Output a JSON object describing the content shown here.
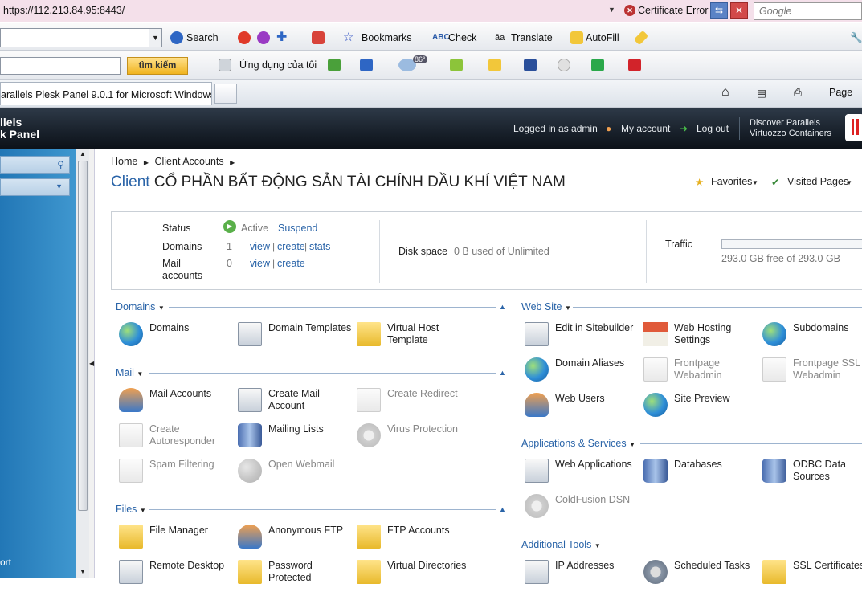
{
  "browser": {
    "url": "https://112.213.84.95:8443/",
    "cert_error": "Certificate Error",
    "search_placeholder": "Google",
    "toolbar1": {
      "search": "Search",
      "bookmarks": "Bookmarks",
      "check": "Check",
      "translate": "Translate",
      "autofill": "AutoFill"
    },
    "toolbar2": {
      "btn": "tìm kiếm",
      "apps": "Ứng dụng của tôi",
      "weather": "86°"
    },
    "tab_title": "arallels Plesk Panel 9.0.1 for Microsoft Windows",
    "page_menu": "Page"
  },
  "header": {
    "brand_line1": "llels",
    "brand_line2": "k Panel",
    "logged_in": "Logged in as admin",
    "my_account": "My account",
    "log_out": "Log out",
    "discover_l1": "Discover Parallels",
    "discover_l2": "Virtuozzo Containers"
  },
  "leftnav": {
    "bottom_text": "ort"
  },
  "main": {
    "breadcrumb": [
      "Home",
      "Client Accounts"
    ],
    "title_prefix": "Client",
    "title": "CỔ PHẦN BẤT ĐỘNG SẢN TÀI CHÍNH DẦU KHÍ VIỆT NAM",
    "favorites": "Favorites",
    "visited": "Visited Pages",
    "info": {
      "status_label": "Status",
      "status_value": "Active",
      "suspend": "Suspend",
      "domains_label": "Domains",
      "domains_count": "1",
      "view": "view",
      "create": "create",
      "stats": "stats",
      "mail_label1": "Mail",
      "mail_label2": "accounts",
      "mail_count": "0",
      "disk_label": "Disk space",
      "disk_value": "0 B used of Unlimited",
      "traffic_label": "Traffic",
      "traffic_value": "293.0 GB free of 293.0 GB",
      "traffic_used_fraction": 0
    },
    "sections": {
      "domains": {
        "title": "Domains",
        "items": [
          {
            "l1": "Domains",
            "l2": ""
          },
          {
            "l1": "Domain Templates",
            "l2": ""
          },
          {
            "l1": "Virtual Host",
            "l2": "Template"
          }
        ]
      },
      "mail": {
        "title": "Mail",
        "items": [
          {
            "l1": "Mail Accounts",
            "l2": ""
          },
          {
            "l1": "Create Mail",
            "l2": "Account"
          },
          {
            "l1": "Create Redirect",
            "l2": ""
          },
          {
            "l1": "Create",
            "l2": "Autoresponder"
          },
          {
            "l1": "Mailing Lists",
            "l2": ""
          },
          {
            "l1": "Virus Protection",
            "l2": ""
          },
          {
            "l1": "Spam Filtering",
            "l2": ""
          },
          {
            "l1": "Open Webmail",
            "l2": ""
          }
        ]
      },
      "files": {
        "title": "Files",
        "items": [
          {
            "l1": "File Manager",
            "l2": ""
          },
          {
            "l1": "Anonymous FTP",
            "l2": ""
          },
          {
            "l1": "FTP Accounts",
            "l2": ""
          },
          {
            "l1": "Remote Desktop",
            "l2": ""
          },
          {
            "l1": "Password",
            "l2": "Protected"
          },
          {
            "l1": "Virtual Directories",
            "l2": ""
          }
        ]
      },
      "website": {
        "title": "Web Site",
        "items": [
          {
            "l1": "Edit in Sitebuilder",
            "l2": ""
          },
          {
            "l1": "Web Hosting",
            "l2": "Settings"
          },
          {
            "l1": "Subdomains",
            "l2": ""
          },
          {
            "l1": "Domain Aliases",
            "l2": ""
          },
          {
            "l1": "Frontpage",
            "l2": "Webadmin"
          },
          {
            "l1": "Frontpage SSL",
            "l2": "Webadmin"
          },
          {
            "l1": "Web Users",
            "l2": ""
          },
          {
            "l1": "Site Preview",
            "l2": ""
          }
        ]
      },
      "apps": {
        "title": "Applications & Services",
        "items": [
          {
            "l1": "Web Applications",
            "l2": ""
          },
          {
            "l1": "Databases",
            "l2": ""
          },
          {
            "l1": "ODBC Data",
            "l2": "Sources"
          },
          {
            "l1": "ColdFusion DSN",
            "l2": ""
          }
        ]
      },
      "tools": {
        "title": "Additional Tools",
        "items": [
          {
            "l1": "IP Addresses",
            "l2": ""
          },
          {
            "l1": "Scheduled Tasks",
            "l2": ""
          },
          {
            "l1": "SSL Certificates",
            "l2": ""
          }
        ]
      }
    }
  }
}
